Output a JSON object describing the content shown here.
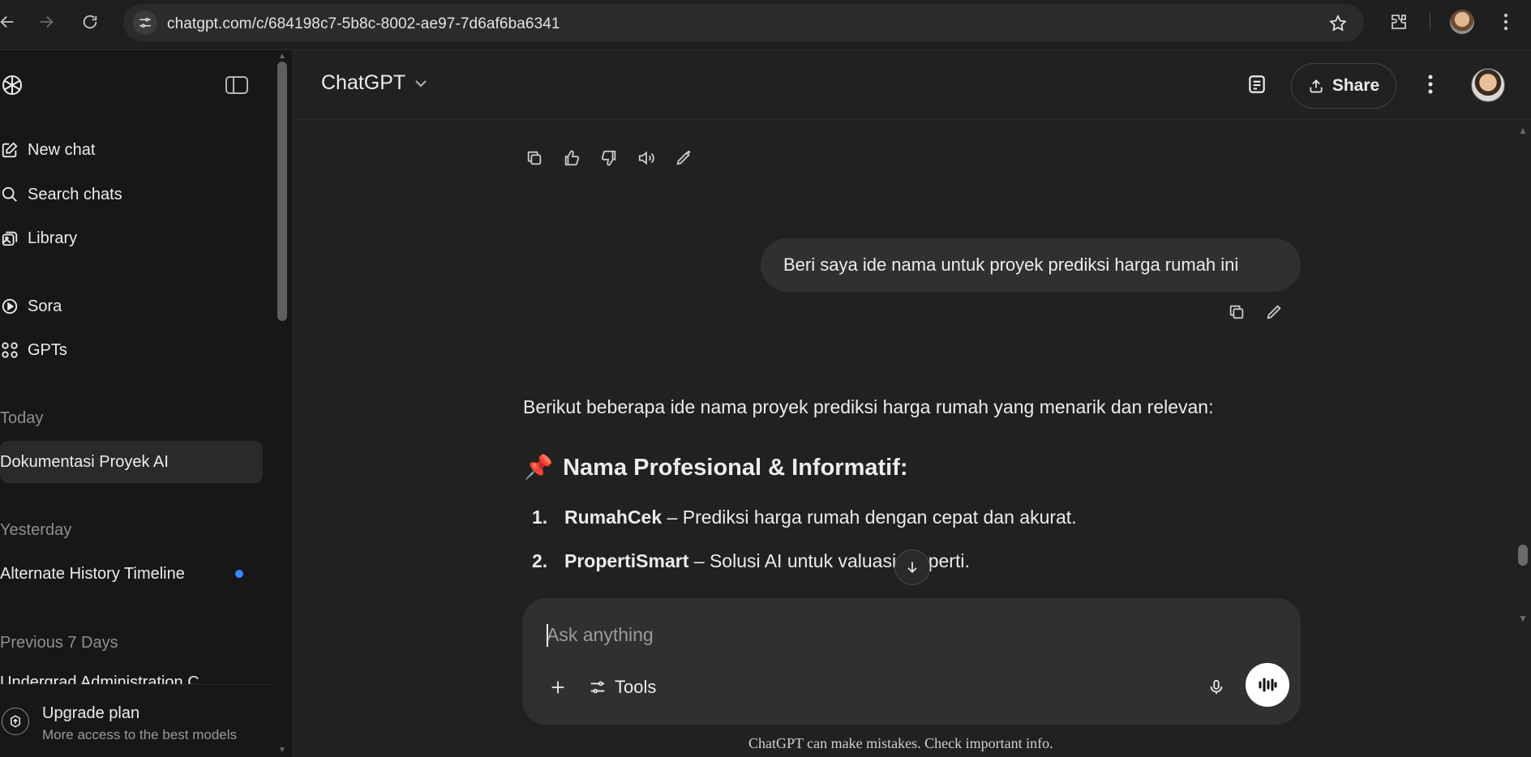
{
  "browser": {
    "url": "chatgpt.com/c/684198c7-5b8c-8002-ae97-7d6af6ba6341"
  },
  "sidebar": {
    "nav": [
      {
        "label": "New chat",
        "icon": "pencil-square-icon"
      },
      {
        "label": "Search chats",
        "icon": "search-icon"
      },
      {
        "label": "Library",
        "icon": "library-icon"
      },
      {
        "label": "Sora",
        "icon": "play-circle-icon"
      },
      {
        "label": "GPTs",
        "icon": "grid-icon"
      }
    ],
    "sections": [
      {
        "title": "Today",
        "chats": [
          "Dokumentasi Proyek AI"
        ]
      },
      {
        "title": "Yesterday",
        "chats": [
          "Alternate History Timeline"
        ]
      },
      {
        "title": "Previous 7 Days",
        "chats": [
          "Undergrad Administration C..."
        ]
      }
    ],
    "upgrade": {
      "title": "Upgrade plan",
      "subtitle": "More access to the best models"
    }
  },
  "header": {
    "model": "ChatGPT",
    "share_label": "Share"
  },
  "conversation": {
    "user_message": "Beri saya ide nama untuk proyek prediksi harga rumah ini",
    "assistant_intro": "Berikut beberapa ide nama proyek prediksi harga rumah yang menarik dan relevan:",
    "heading_emoji": "📌",
    "heading": "Nama Profesional & Informatif:",
    "items": [
      {
        "num": "1.",
        "name": "RumahCek",
        "desc": " – Prediksi harga rumah dengan cepat dan akurat."
      },
      {
        "num": "2.",
        "name": "PropertiSmart",
        "desc": " – Solusi AI untuk valuasi properti."
      }
    ]
  },
  "composer": {
    "placeholder": "Ask anything",
    "tools_label": "Tools"
  },
  "disclaimer": "ChatGPT can make mistakes. Check important info."
}
